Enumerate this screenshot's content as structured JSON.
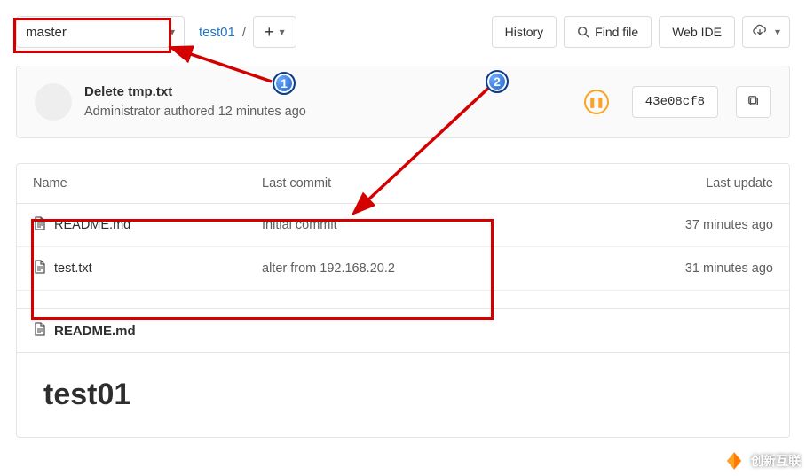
{
  "branch": {
    "selected": "master"
  },
  "breadcrumb": {
    "repo": "test01"
  },
  "toolbar": {
    "history": "History",
    "find_file": "Find file",
    "web_ide": "Web IDE"
  },
  "commit": {
    "title": "Delete tmp.txt",
    "author_line_prefix": "Administrator authored ",
    "author_time": "12 minutes ago",
    "sha": "43e08cf8",
    "pipeline_glyph": "❚❚"
  },
  "table": {
    "col_name": "Name",
    "col_commit": "Last commit",
    "col_update": "Last update",
    "rows": [
      {
        "name": "README.md",
        "commit": "Initial commit",
        "update": "37 minutes ago"
      },
      {
        "name": "test.txt",
        "commit": "alter from 192.168.20.2",
        "update": "31 minutes ago"
      }
    ]
  },
  "readme": {
    "filename": "README.md",
    "heading": "test01"
  },
  "annotations": {
    "callout1": "1",
    "callout2": "2"
  },
  "watermark": {
    "text": "创新互联"
  },
  "colors": {
    "annotation_red": "#d40000",
    "callout_blue": "#1b5fc9",
    "pipeline_orange": "#fca326"
  }
}
